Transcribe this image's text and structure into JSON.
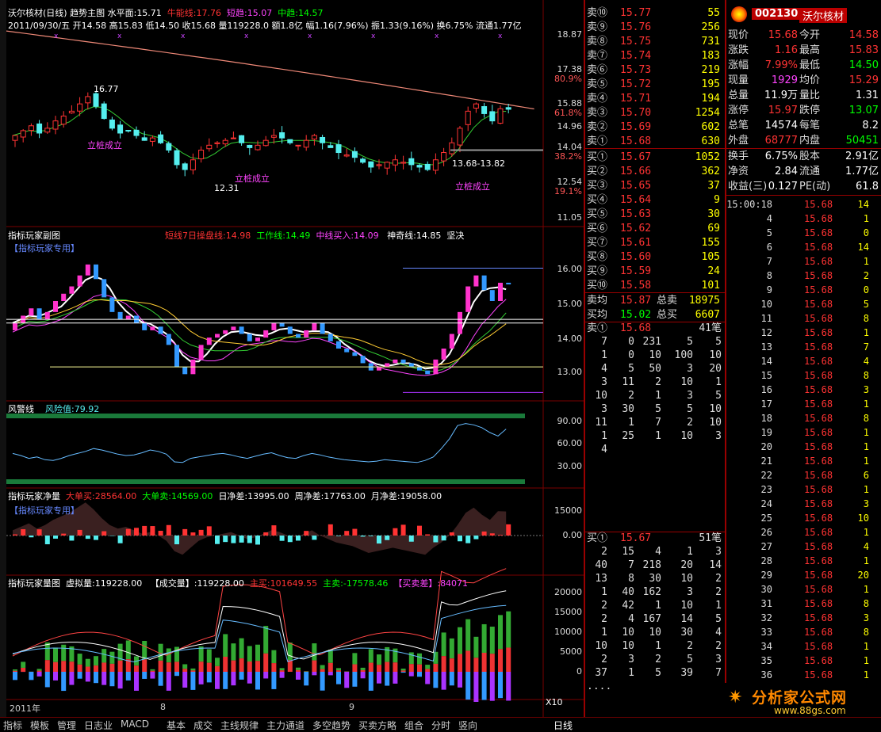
{
  "header": {
    "title": "沃尔核材(日线)",
    "chart_name": "趋势主图",
    "level_label": "水平面:",
    "level_value": "15.71",
    "niuneng_label": "牛能线:",
    "niuneng_value": "17.76",
    "duanqu_label": "短趋:",
    "duanqu_value": "15.07",
    "zhongqu_label": "中趋:",
    "zhongqu_value": "14.57",
    "ohlc_line": "2011/09/30/五 开14.58 高15.83 低14.50 收15.68 量119228.0 额1.8亿 幅1.16(7.96%) 振1.33(9.16%) 换6.75% 流通1.77亿"
  },
  "main_chart": {
    "y_labels": [
      "18.87",
      "17.38",
      "80.9%",
      "15.88",
      "61.8%",
      "14.96",
      "14.04",
      "38.2%",
      "12.54",
      "19.1%",
      "11.05"
    ],
    "annotations": [
      "16.77",
      "12.31",
      "13.68-13.82"
    ],
    "signal_text": "立桩成立"
  },
  "sub_chart": {
    "title": "指标玩家副图",
    "badge": "【指标玩家专用】",
    "line1_label": "短线7日操盘线:",
    "line1_value": "14.98",
    "line2_label": "工作线:",
    "line2_value": "14.49",
    "line3_label": "中线买入:",
    "line3_value": "14.09",
    "line4_label": "神奇线:",
    "line4_value": "14.85",
    "line5": "坚决",
    "y_labels": [
      "16.00",
      "15.00",
      "14.00",
      "13.00"
    ]
  },
  "risk_chart": {
    "title": "风警线",
    "value_label": "风险值:",
    "value": "79.92",
    "y_labels": [
      "90.00",
      "60.00",
      "30.00"
    ]
  },
  "net_chart": {
    "title": "指标玩家净量",
    "badge": "【指标玩家专用】",
    "big_buy_label": "大单买:",
    "big_buy": "28564.00",
    "big_sell_label": "大单卖:",
    "big_sell": "14569.00",
    "day_diff_label": "日净差:",
    "day_diff": "13995.00",
    "week_diff_label": "周净差:",
    "week_diff": "17763.00",
    "month_diff_label": "月净差:",
    "month_diff": "19058.00",
    "y_labels": [
      "15000",
      "0.00"
    ]
  },
  "vol_chart": {
    "title": "指标玩家量图",
    "vvol_label": "虚拟量:",
    "vvol": "119228.00",
    "deal_label": "【成交量】:",
    "deal": "119228.00",
    "main_buy_label": "主买:",
    "main_buy": "101649.55",
    "main_sell_label": "主卖:",
    "main_sell": "-17578.46",
    "diff_label": "【买卖差】:",
    "diff": "84071",
    "y_labels": [
      "20000",
      "15000",
      "10000",
      "5000",
      "0"
    ],
    "x10": "X10"
  },
  "timeline": {
    "year": "2011年",
    "m8": "8",
    "m9": "9"
  },
  "bottom_tabs": [
    "指标",
    "模板",
    "管理",
    "日志业",
    "MACD",
    "基本",
    "成交",
    "主线规律",
    "主力通道",
    "多空趋势",
    "买卖方略",
    "组合",
    "分时",
    "竖向"
  ],
  "period": "日线",
  "order_book": {
    "sell": [
      {
        "label": "卖⑩",
        "price": "15.77",
        "vol": "55"
      },
      {
        "label": "卖⑨",
        "price": "15.76",
        "vol": "256"
      },
      {
        "label": "卖⑧",
        "price": "15.75",
        "vol": "731"
      },
      {
        "label": "卖⑦",
        "price": "15.74",
        "vol": "183"
      },
      {
        "label": "卖⑥",
        "price": "15.73",
        "vol": "219"
      },
      {
        "label": "卖⑤",
        "price": "15.72",
        "vol": "195"
      },
      {
        "label": "卖④",
        "price": "15.71",
        "vol": "194"
      },
      {
        "label": "卖③",
        "price": "15.70",
        "vol": "1254"
      },
      {
        "label": "卖②",
        "price": "15.69",
        "vol": "602"
      },
      {
        "label": "卖①",
        "price": "15.68",
        "vol": "630"
      }
    ],
    "buy": [
      {
        "label": "买①",
        "price": "15.67",
        "vol": "1052"
      },
      {
        "label": "买②",
        "price": "15.66",
        "vol": "362"
      },
      {
        "label": "买③",
        "price": "15.65",
        "vol": "37"
      },
      {
        "label": "买④",
        "price": "15.64",
        "vol": "9"
      },
      {
        "label": "买⑤",
        "price": "15.63",
        "vol": "30"
      },
      {
        "label": "买⑥",
        "price": "15.62",
        "vol": "69"
      },
      {
        "label": "买⑦",
        "price": "15.61",
        "vol": "155"
      },
      {
        "label": "买⑧",
        "price": "15.60",
        "vol": "105"
      },
      {
        "label": "买⑨",
        "price": "15.59",
        "vol": "24"
      },
      {
        "label": "买⑩",
        "price": "15.58",
        "vol": "101"
      }
    ],
    "sell_avg_label": "卖均",
    "sell_avg": "15.87",
    "total_sell_label": "总卖",
    "total_sell": "18975",
    "buy_avg_label": "买均",
    "buy_avg": "15.02",
    "total_buy_label": "总买",
    "total_buy": "6607",
    "queue_sell_header": {
      "label": "卖①",
      "price": "15.68",
      "count": "41笔"
    },
    "queue_sell": [
      [
        "7",
        "0",
        "231",
        "5",
        "5"
      ],
      [
        "1",
        "0",
        "10",
        "100",
        "10"
      ],
      [
        "4",
        "5",
        "50",
        "3",
        "20"
      ],
      [
        "3",
        "11",
        "2",
        "10",
        "1"
      ],
      [
        "10",
        "2",
        "1",
        "3",
        "5"
      ],
      [
        "3",
        "30",
        "5",
        "5",
        "10"
      ],
      [
        "11",
        "1",
        "7",
        "2",
        "10"
      ],
      [
        "1",
        "25",
        "1",
        "10",
        "3"
      ],
      [
        "4",
        "",
        "",
        "",
        ""
      ]
    ],
    "queue_buy_header": {
      "label": "买①",
      "price": "15.67",
      "count": "51笔"
    },
    "queue_buy": [
      [
        "2",
        "15",
        "4",
        "1",
        "3"
      ],
      [
        "40",
        "7",
        "218",
        "20",
        "14"
      ],
      [
        "13",
        "8",
        "30",
        "10",
        "2"
      ],
      [
        "1",
        "40",
        "162",
        "3",
        "2"
      ],
      [
        "2",
        "42",
        "1",
        "10",
        "1"
      ],
      [
        "2",
        "4",
        "167",
        "14",
        "5"
      ],
      [
        "1",
        "10",
        "10",
        "30",
        "4"
      ],
      [
        "10",
        "10",
        "1",
        "2",
        "2"
      ],
      [
        "2",
        "3",
        "2",
        "5",
        "3"
      ],
      [
        "37",
        "1",
        "5",
        "39",
        "7"
      ],
      [
        "....",
        "",
        "",
        "",
        ""
      ]
    ]
  },
  "quote": {
    "code": "002130",
    "name": "沃尔核材",
    "rows": [
      {
        "l1": "现价",
        "v1": "15.68",
        "l2": "今开",
        "v2": "14.58"
      },
      {
        "l1": "涨跌",
        "v1": "1.16",
        "l2": "最高",
        "v2": "15.83"
      },
      {
        "l1": "涨幅",
        "v1": "7.99%",
        "l2": "最低",
        "v2": "14.50"
      },
      {
        "l1": "现量",
        "v1": "1929",
        "l2": "均价",
        "v2": "15.29"
      },
      {
        "l1": "总量",
        "v1": "11.9万",
        "l2": "量比",
        "v2": "1.31"
      },
      {
        "l1": "涨停",
        "v1": "15.97",
        "l2": "跌停",
        "v2": "13.07"
      },
      {
        "l1": "总笔",
        "v1": "14574",
        "l2": "每笔",
        "v2": "8.2"
      },
      {
        "l1": "外盘",
        "v1": "68777",
        "l2": "内盘",
        "v2": "50451"
      }
    ],
    "rows2": [
      {
        "l1": "换手",
        "v1": "6.75%",
        "l2": "股本",
        "v2": "2.91亿"
      },
      {
        "l1": "净资",
        "v1": "2.84",
        "l2": "流通",
        "v2": "1.77亿"
      },
      {
        "l1": "收益(三)",
        "v1": "0.127",
        "l2": "PE(动)",
        "v2": "61.8"
      }
    ]
  },
  "ticks": {
    "first_time": "15:00:18",
    "price": "15.68",
    "rows": [
      {
        "t": "15:00:18",
        "v": "14"
      },
      {
        "t": "4",
        "v": "1"
      },
      {
        "t": "5",
        "v": "0"
      },
      {
        "t": "6",
        "v": "14"
      },
      {
        "t": "7",
        "v": "1"
      },
      {
        "t": "8",
        "v": "2"
      },
      {
        "t": "9",
        "v": "0"
      },
      {
        "t": "10",
        "v": "5"
      },
      {
        "t": "11",
        "v": "8"
      },
      {
        "t": "12",
        "v": "1"
      },
      {
        "t": "13",
        "v": "7"
      },
      {
        "t": "14",
        "v": "4"
      },
      {
        "t": "15",
        "v": "8"
      },
      {
        "t": "16",
        "v": "3"
      },
      {
        "t": "17",
        "v": "1"
      },
      {
        "t": "18",
        "v": "8"
      },
      {
        "t": "19",
        "v": "1"
      },
      {
        "t": "20",
        "v": "1"
      },
      {
        "t": "21",
        "v": "1"
      },
      {
        "t": "22",
        "v": "6"
      },
      {
        "t": "23",
        "v": "1"
      },
      {
        "t": "24",
        "v": "3"
      },
      {
        "t": "25",
        "v": "10"
      },
      {
        "t": "26",
        "v": "1"
      },
      {
        "t": "27",
        "v": "4"
      },
      {
        "t": "28",
        "v": "1"
      },
      {
        "t": "29",
        "v": "20"
      },
      {
        "t": "30",
        "v": "1"
      },
      {
        "t": "31",
        "v": "8"
      },
      {
        "t": "32",
        "v": "3"
      },
      {
        "t": "33",
        "v": "8"
      },
      {
        "t": "34",
        "v": "1"
      },
      {
        "t": "35",
        "v": "1"
      },
      {
        "t": "36",
        "v": "1"
      }
    ]
  },
  "watermark": {
    "brand": "分析家公式网",
    "url": "www.88gs.com"
  },
  "colors": {
    "up": "#ff3333",
    "down": "#55eeee",
    "grid": "#7a0000",
    "accent": "#ffff00"
  }
}
